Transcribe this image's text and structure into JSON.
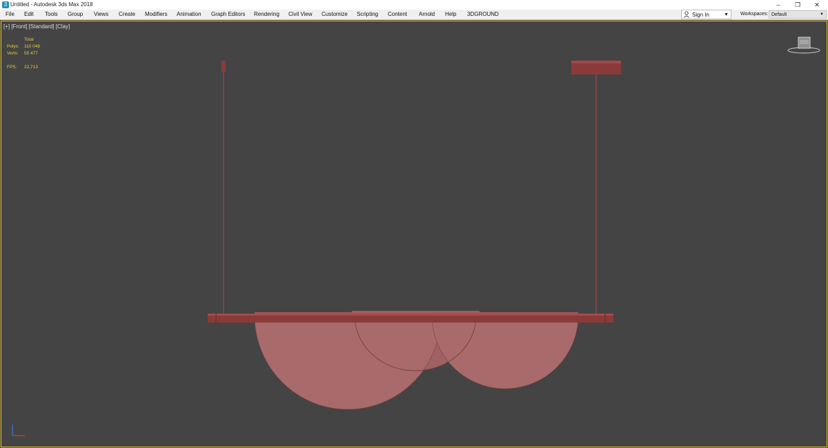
{
  "window": {
    "title": "Untitled - Autodesk 3ds Max 2018",
    "minimize_glyph": "–",
    "restore_glyph": "❐",
    "close_glyph": "✕"
  },
  "menu": {
    "items": [
      "File",
      "Edit",
      "Tools",
      "Group",
      "Views",
      "Create",
      "Modifiers",
      "Animation",
      "Graph Editors",
      "Rendering",
      "Civil View",
      "Customize",
      "Scripting",
      "Content",
      "Arnold",
      "Help",
      "3DGROUND"
    ]
  },
  "account": {
    "signin_label": "Sign In",
    "workspaces_label": "Workspaces:",
    "workspace_value": "Default"
  },
  "viewport": {
    "label": "[+] [Front] [Standard] [Clay]",
    "stats": {
      "header": "Total",
      "polys_label": "Polys:",
      "polys_value": "110 048",
      "verts_label": "Verts:",
      "verts_value": "55 477",
      "fps_label": "FPS:",
      "fps_value": "22,713"
    }
  },
  "colors": {
    "viewport_bg": "#444444",
    "active_border": "#f2c51a",
    "stats_text": "#e8cc3a",
    "model_clay": "#a86a6a",
    "model_dark": "#8b3a3a"
  },
  "icons": [
    "app-icon",
    "user-icon",
    "chevron-down-icon",
    "viewcube-icon",
    "axis-gizmo-icon"
  ]
}
